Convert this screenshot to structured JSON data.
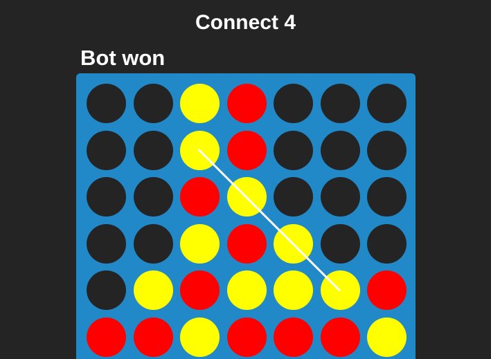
{
  "title": "Connect 4",
  "status": "Bot won",
  "colors": {
    "background": "#242424",
    "board": "#2289c9",
    "empty": "#242424",
    "red": "#ff0000",
    "yellow": "#ffff00",
    "win_line": "#ffffff"
  },
  "board": {
    "rows": 6,
    "cols": 7,
    "cells": [
      [
        "empty",
        "empty",
        "yellow",
        "red",
        "empty",
        "empty",
        "empty"
      ],
      [
        "empty",
        "empty",
        "yellow",
        "red",
        "empty",
        "empty",
        "empty"
      ],
      [
        "empty",
        "empty",
        "red",
        "yellow",
        "empty",
        "empty",
        "empty"
      ],
      [
        "empty",
        "empty",
        "yellow",
        "red",
        "yellow",
        "empty",
        "empty"
      ],
      [
        "empty",
        "yellow",
        "red",
        "yellow",
        "yellow",
        "yellow",
        "red"
      ],
      [
        "red",
        "red",
        "yellow",
        "red",
        "red",
        "red",
        "yellow"
      ]
    ]
  },
  "winning_line": {
    "from": {
      "row": 1,
      "col": 2
    },
    "to": {
      "row": 4,
      "col": 5
    }
  }
}
